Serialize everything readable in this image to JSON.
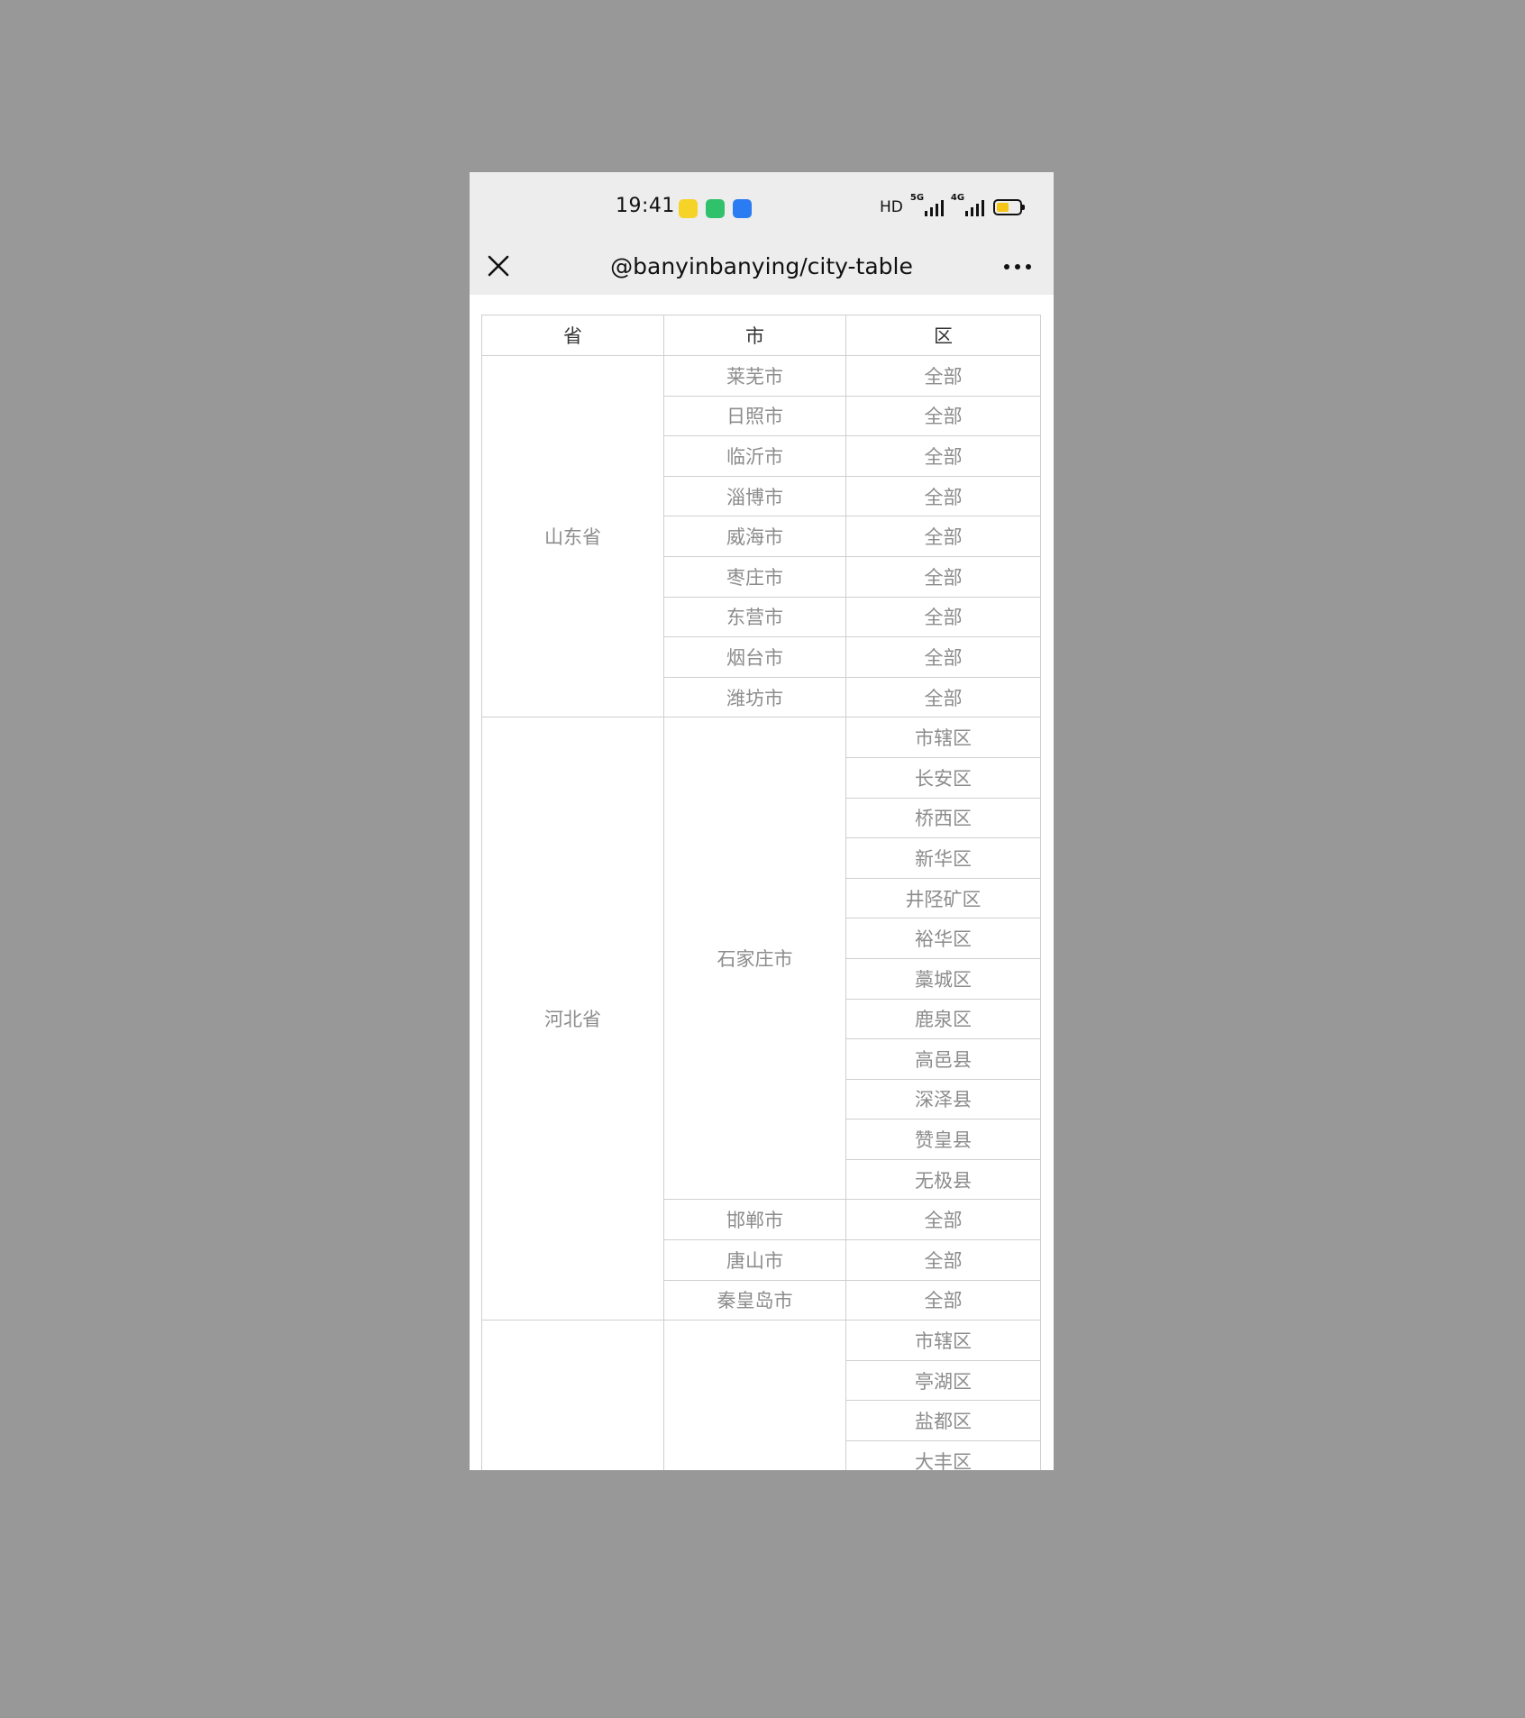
{
  "status_bar": {
    "time": "19:41",
    "notification_icons": [
      {
        "name": "notification-app-icon-1",
        "color": "#f5d327"
      },
      {
        "name": "notification-app-icon-2",
        "color": "#2fc26b"
      },
      {
        "name": "notification-app-icon-3",
        "color": "#2b7cf2"
      }
    ],
    "hd_label": "HD",
    "network_1": "5G",
    "network_2": "4G",
    "battery_color": "#f5c518",
    "battery_level": 0.55
  },
  "nav": {
    "title": "@banyinbanying/city-table",
    "close_icon": "close-icon",
    "more_icon": "more-dots-icon"
  },
  "table": {
    "headers": [
      "省",
      "市",
      "区"
    ],
    "provinces": [
      {
        "name": "山东省",
        "cities": [
          {
            "name": "莱芜市",
            "districts": [
              "全部"
            ]
          },
          {
            "name": "日照市",
            "districts": [
              "全部"
            ]
          },
          {
            "name": "临沂市",
            "districts": [
              "全部"
            ]
          },
          {
            "name": "淄博市",
            "districts": [
              "全部"
            ]
          },
          {
            "name": "威海市",
            "districts": [
              "全部"
            ]
          },
          {
            "name": "枣庄市",
            "districts": [
              "全部"
            ]
          },
          {
            "name": "东营市",
            "districts": [
              "全部"
            ]
          },
          {
            "name": "烟台市",
            "districts": [
              "全部"
            ]
          },
          {
            "name": "潍坊市",
            "districts": [
              "全部"
            ]
          }
        ]
      },
      {
        "name": "河北省",
        "cities": [
          {
            "name": "石家庄市",
            "districts": [
              "市辖区",
              "长安区",
              "桥西区",
              "新华区",
              "井陉矿区",
              "裕华区",
              "藁城区",
              "鹿泉区",
              "高邑县",
              "深泽县",
              "赞皇县",
              "无极县"
            ]
          },
          {
            "name": "邯郸市",
            "districts": [
              "全部"
            ]
          },
          {
            "name": "唐山市",
            "districts": [
              "全部"
            ]
          },
          {
            "name": "秦皇岛市",
            "districts": [
              "全部"
            ]
          }
        ]
      },
      {
        "name": "",
        "cities": [
          {
            "name": "",
            "districts": [
              "市辖区",
              "亭湖区",
              "盐都区",
              "大丰区"
            ]
          }
        ]
      }
    ]
  }
}
